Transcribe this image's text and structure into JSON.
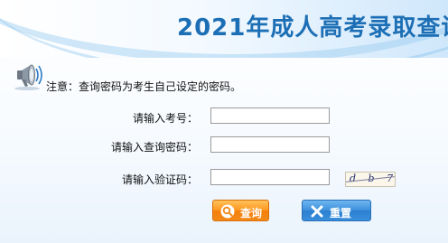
{
  "header": {
    "title": "2021年成人高考录取查询"
  },
  "notice": {
    "icon": "megaphone-icon",
    "text": "注意：查询密码为考生自己设定的密码。"
  },
  "form": {
    "exam_number": {
      "label": "请输入考号：",
      "value": ""
    },
    "password": {
      "label": "请输入查询密码：",
      "value": ""
    },
    "captcha_input": {
      "label": "请输入验证码：",
      "value": ""
    },
    "captcha_image_text": "d b 7 3"
  },
  "buttons": {
    "search": {
      "label": "查询",
      "icon": "search-icon"
    },
    "reset": {
      "label": "重置",
      "icon": "close-icon"
    }
  },
  "colors": {
    "title": "#1d6fb5",
    "search_button": "#ff9922",
    "reset_button": "#3d91dc"
  }
}
